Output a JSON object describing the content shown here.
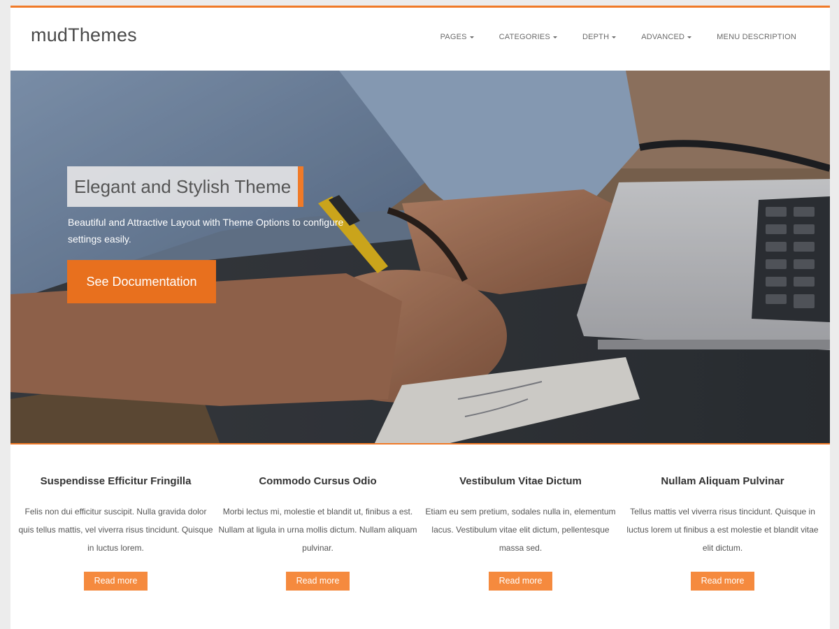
{
  "site": {
    "logo": "mudThemes",
    "accent_color": "#f07a28"
  },
  "nav": {
    "items": [
      {
        "label": "PAGES",
        "has_dropdown": true
      },
      {
        "label": "CATEGORIES",
        "has_dropdown": true
      },
      {
        "label": "DEPTH",
        "has_dropdown": true
      },
      {
        "label": "ADVANCED",
        "has_dropdown": true
      },
      {
        "label": "MENU DESCRIPTION",
        "has_dropdown": false
      }
    ]
  },
  "hero": {
    "title": "Elegant and Stylish Theme",
    "subtitle": "Beautiful and Attractive Layout with Theme Options to configure settings easily.",
    "button_label": "See Documentation"
  },
  "features": [
    {
      "title": "Suspendisse Efficitur Fringilla",
      "text": "Felis non dui efficitur suscipit. Nulla gravida dolor quis tellus mattis, vel viverra risus tincidunt. Quisque in luctus lorem.",
      "button_label": "Read more"
    },
    {
      "title": "Commodo Cursus Odio",
      "text": "Morbi lectus mi, molestie et blandit ut, finibus a est. Nullam at ligula in urna mollis dictum. Nullam aliquam pulvinar.",
      "button_label": "Read more"
    },
    {
      "title": "Vestibulum Vitae Dictum",
      "text": "Etiam eu sem pretium, sodales nulla in, elementum lacus. Vestibulum vitae elit dictum, pellentesque massa sed.",
      "button_label": "Read more"
    },
    {
      "title": "Nullam Aliquam Pulvinar",
      "text": "Tellus mattis vel viverra risus tincidunt. Quisque in luctus lorem ut finibus a est molestie et blandit vitae elit dictum.",
      "button_label": "Read more"
    }
  ]
}
